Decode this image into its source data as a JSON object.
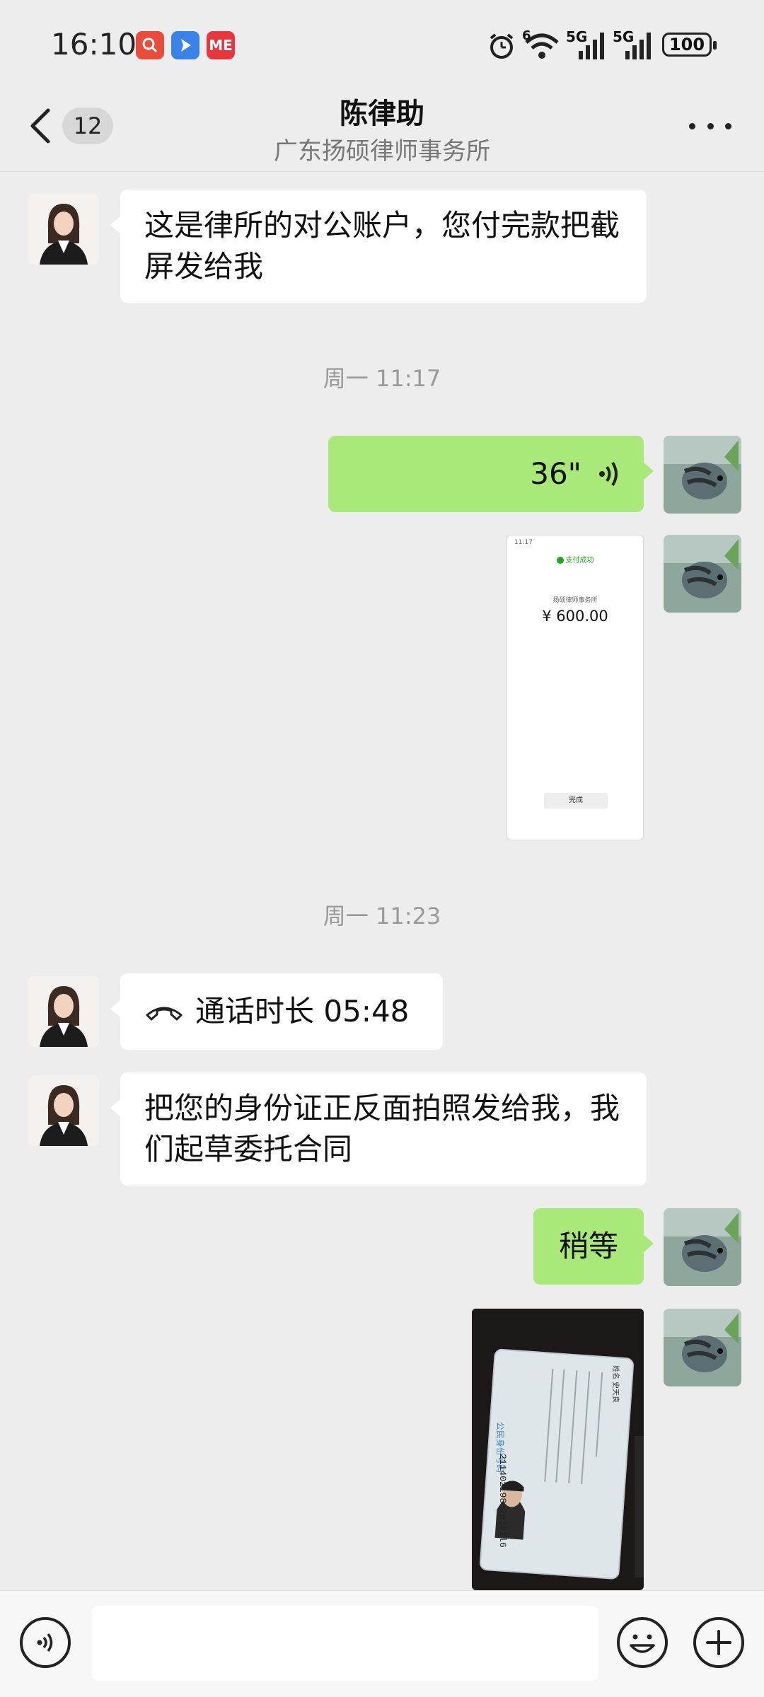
{
  "status_bar": {
    "time": "16:10",
    "app_icons": [
      "search-app-icon",
      "navigation-app-icon",
      "me-app-icon"
    ],
    "me_icon_label": "ME",
    "signal_labels": [
      "6",
      "5G",
      "5G"
    ],
    "battery": "100"
  },
  "header": {
    "badge_count": "12",
    "title": "陈律助",
    "subtitle": "广东扬硕律师事务所"
  },
  "messages": {
    "m1": "这是律所的对公账户，您付完款把截屏发给我",
    "t1": "周一 11:17",
    "voice_duration": "36\"",
    "payment": {
      "status_time": "11:17",
      "success_text": "支付成功",
      "merchant": "扬硕律师事务所",
      "amount": "¥ 600.00",
      "done_label": "完成"
    },
    "t2": "周一 11:23",
    "call_text": "通话时长 05:48",
    "m2": "把您的身份证正反面拍照发给我，我们起草委托合同",
    "m3": "稍等",
    "id_card": {
      "name_label": "姓名",
      "name": "史天良",
      "id_label": "公民身份号码",
      "id_number": "211402198020302l6"
    }
  },
  "colors": {
    "background": "#ededed",
    "bubble_right": "#a9e97a",
    "bubble_left": "#ffffff"
  }
}
